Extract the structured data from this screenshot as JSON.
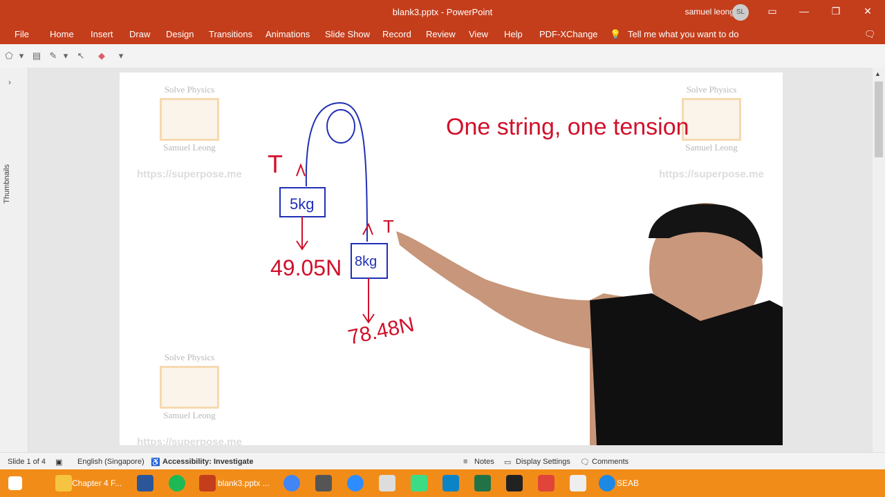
{
  "window": {
    "title": "blank3.pptx - PowerPoint",
    "user_name": "samuel leong",
    "user_initials": "SL"
  },
  "menu": [
    "File",
    "Home",
    "Insert",
    "Draw",
    "Design",
    "Transitions",
    "Animations",
    "Slide Show",
    "Record",
    "Review",
    "View",
    "Help",
    "PDF-XChange"
  ],
  "tell_me": "Tell me what you want to do",
  "thumbnails_label": "Thumbnails",
  "slide": {
    "watermark_title": "Solve Physics",
    "watermark_name": "Samuel Leong",
    "watermark_url": "https://superpose.me",
    "ink": {
      "heading": "One string, one tension",
      "mass_left": "5kg",
      "mass_right": "8kg",
      "weight_left": "49.05N",
      "weight_right": "78.48N",
      "tension_label": "T"
    }
  },
  "status": {
    "slide_info": "Slide 1 of 4",
    "language": "English (Singapore)",
    "accessibility": "Accessibility: Investigate",
    "notes": "Notes",
    "display_settings": "Display Settings",
    "comments": "Comments"
  },
  "taskbar": {
    "items": [
      "Chapter 4 F...",
      "blank3.pptx ...",
      "SEAB"
    ]
  },
  "colors": {
    "accent": "#c43e1c",
    "ink_red": "#d0102a",
    "ink_blue": "#1f2fb5",
    "taskbar": "#f28c18"
  }
}
